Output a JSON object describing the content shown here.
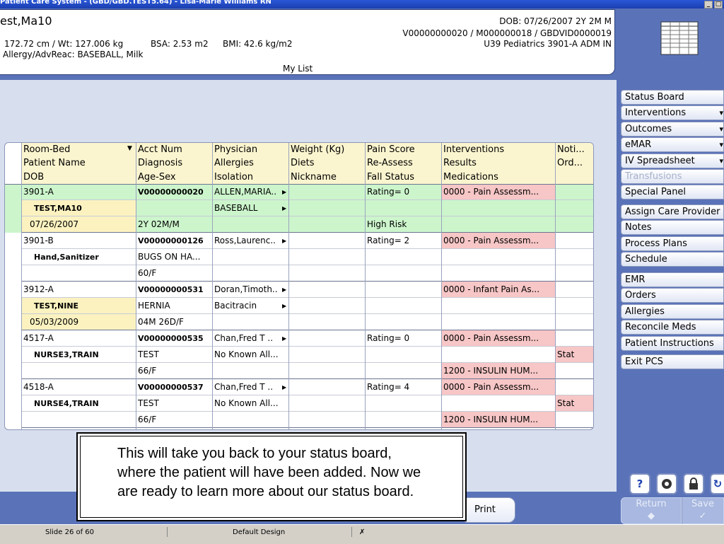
{
  "window": {
    "title": "Patient Care System - (GBD/GBD.TEST5.64) - Lisa-Marie Williams RN"
  },
  "patient_header": {
    "name": "est,Ma10",
    "dob": "DOB: 07/26/2007 2Y 2M M",
    "ht_wt": "172.72 cm / Wt: 127.006 kg",
    "bsa": "BSA: 2.53 m2",
    "bmi": "BMI: 42.6 kg/m2",
    "visit_ids": "V00000000020 / M000000018 / GBDVID0000019",
    "location": "U39 Pediatrics  3901-A  ADM IN",
    "allergy": "Allergy/AdvReac: BASEBALL, Milk",
    "list_name": "My List"
  },
  "grid": {
    "headers": [
      [
        "Room-Bed",
        "Acct Num",
        "Physician",
        "Weight (Kg)",
        "Pain Score",
        "Interventions",
        "Noti..."
      ],
      [
        "Patient Name",
        "Diagnosis",
        "Allergies",
        "Diets",
        "Re-Assess",
        "Results",
        "Ord..."
      ],
      [
        "DOB",
        "Age-Sex",
        "Isolation",
        "Nickname",
        "Fall Status",
        "Medications",
        ""
      ]
    ],
    "patients": [
      {
        "rows": [
          [
            "3901-A",
            "V00000000020",
            "ALLEN,MARIA..",
            "",
            "Rating= 0",
            "0000 - Pain Assessm...",
            ""
          ],
          [
            "TEST,MA10",
            "",
            "BASEBALL",
            "",
            "",
            "",
            ""
          ],
          [
            "07/26/2007",
            "2Y 02M/M",
            "",
            "",
            "High Risk",
            "",
            ""
          ]
        ]
      },
      {
        "rows": [
          [
            "3901-B",
            "V00000000126",
            "Ross,Laurenc..",
            "",
            "Rating= 2",
            "0000 - Pain Assessm...",
            ""
          ],
          [
            "Hand,Sanitizer",
            "BUGS ON HA...",
            "",
            "",
            "",
            "",
            ""
          ],
          [
            "",
            "60/F",
            "",
            "",
            "",
            "",
            ""
          ]
        ]
      },
      {
        "rows": [
          [
            "3912-A",
            "V00000000531",
            "Doran,Timoth..",
            "",
            "",
            "0000 - Infant Pain As...",
            ""
          ],
          [
            "TEST,NINE",
            "HERNIA",
            "Bacitracin",
            "",
            "",
            "",
            ""
          ],
          [
            "05/03/2009",
            "04M 26D/F",
            "",
            "",
            "",
            "",
            ""
          ]
        ]
      },
      {
        "rows": [
          [
            "4517-A",
            "V00000000535",
            "Chan,Fred T ..",
            "",
            "Rating= 0",
            "0000 - Pain Assessm...",
            ""
          ],
          [
            "NURSE3,TRAIN",
            "TEST",
            "No Known All...",
            "",
            "",
            "",
            "Stat"
          ],
          [
            "",
            "66/F",
            "",
            "",
            "",
            "1200 - INSULIN HUM...",
            ""
          ]
        ]
      },
      {
        "rows": [
          [
            "4518-A",
            "V00000000537",
            "Chan,Fred T ..",
            "",
            "Rating= 4",
            "0000 - Pain Assessm...",
            ""
          ],
          [
            "NURSE4,TRAIN",
            "TEST",
            "No Known All...",
            "",
            "",
            "",
            "Stat"
          ],
          [
            "",
            "66/F",
            "",
            "",
            "",
            "1200 - INSULIN HUM...",
            ""
          ]
        ]
      }
    ]
  },
  "sidebar": {
    "groups": [
      [
        "Status Board",
        "Interventions",
        "Outcomes",
        "eMAR",
        "IV Spreadsheet",
        "Transfusions",
        "Special Panel"
      ],
      [
        "Assign Care Provider",
        "Notes",
        "Process Plans",
        "Schedule"
      ],
      [
        "EMR",
        "Orders",
        "Allergies",
        "Reconcile Meds",
        "Patient Instructions"
      ],
      [
        "Exit PCS"
      ]
    ]
  },
  "footer": {
    "print_label": "Print",
    "return_label": "Return",
    "save_label": "Save",
    "help_glyph": "?"
  },
  "callout": {
    "lines": [
      "This will take you back to your status board,",
      "where the patient will have been added. Now we",
      "are ready to learn more about our status board."
    ]
  },
  "statusbar": {
    "slide": "Slide 26 of 60",
    "design": "Default Design"
  },
  "colors": {
    "selected_row": "#ccf5cc",
    "name_highlight": "#fbf2c0",
    "alert_cell": "#f7c6c6",
    "header_bg": "#fbf5cf"
  }
}
